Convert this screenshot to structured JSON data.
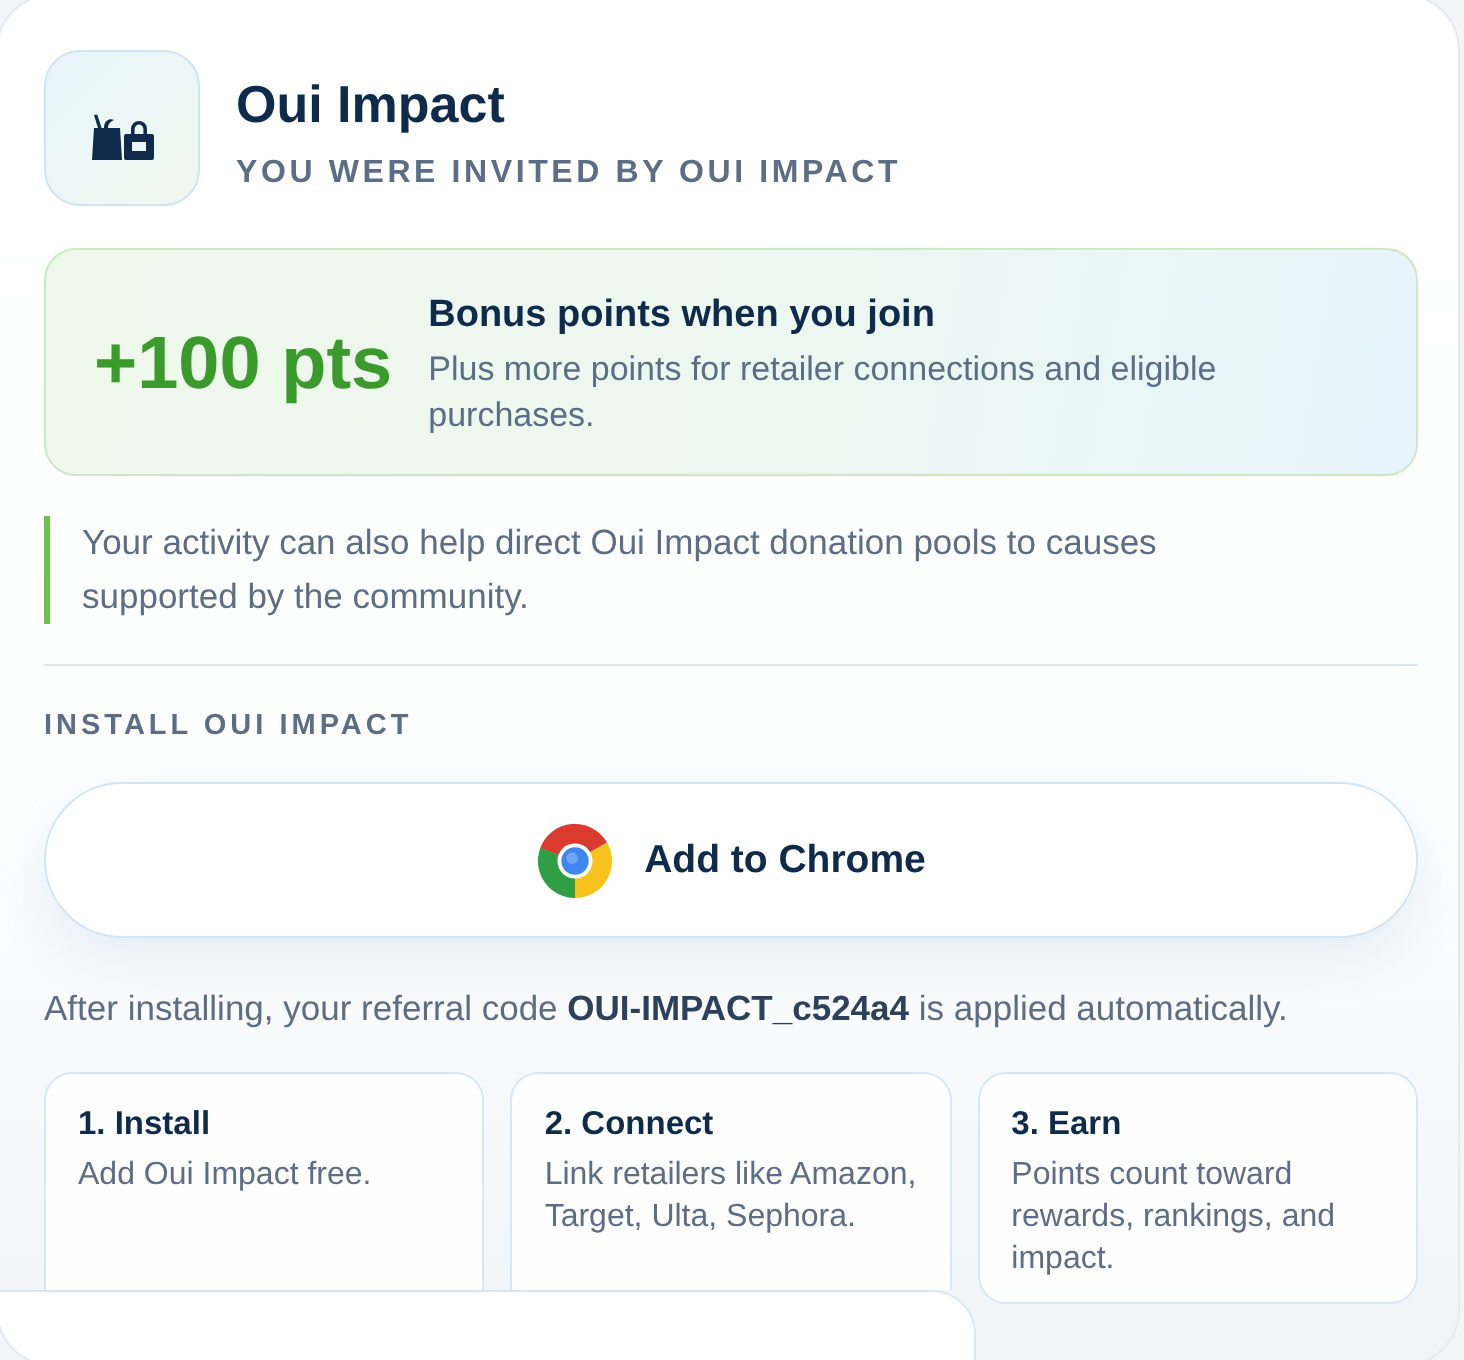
{
  "header": {
    "title": "Oui Impact",
    "subtitle": "YOU WERE INVITED BY OUI IMPACT"
  },
  "bonus": {
    "amount": "+100 pts",
    "title": "Bonus points when you join",
    "description": "Plus more points for retailer connections and eligible purchases."
  },
  "note": "Your activity can also help direct Oui Impact donation pools to causes supported by the community.",
  "install": {
    "heading": "INSTALL OUI IMPACT",
    "button": "Add to Chrome",
    "referral_text": "After installing, your referral code **OUI-IMPACT_c524a4** is applied automatically."
  },
  "steps": [
    {
      "title": "1. Install",
      "description": "Add Oui Impact free."
    },
    {
      "title": "2. Connect",
      "description": "Link retailers like Amazon, Target, Ulta, Sephora."
    },
    {
      "title": "3. Earn",
      "description": "Points count toward rewards, rankings, and impact."
    }
  ]
}
